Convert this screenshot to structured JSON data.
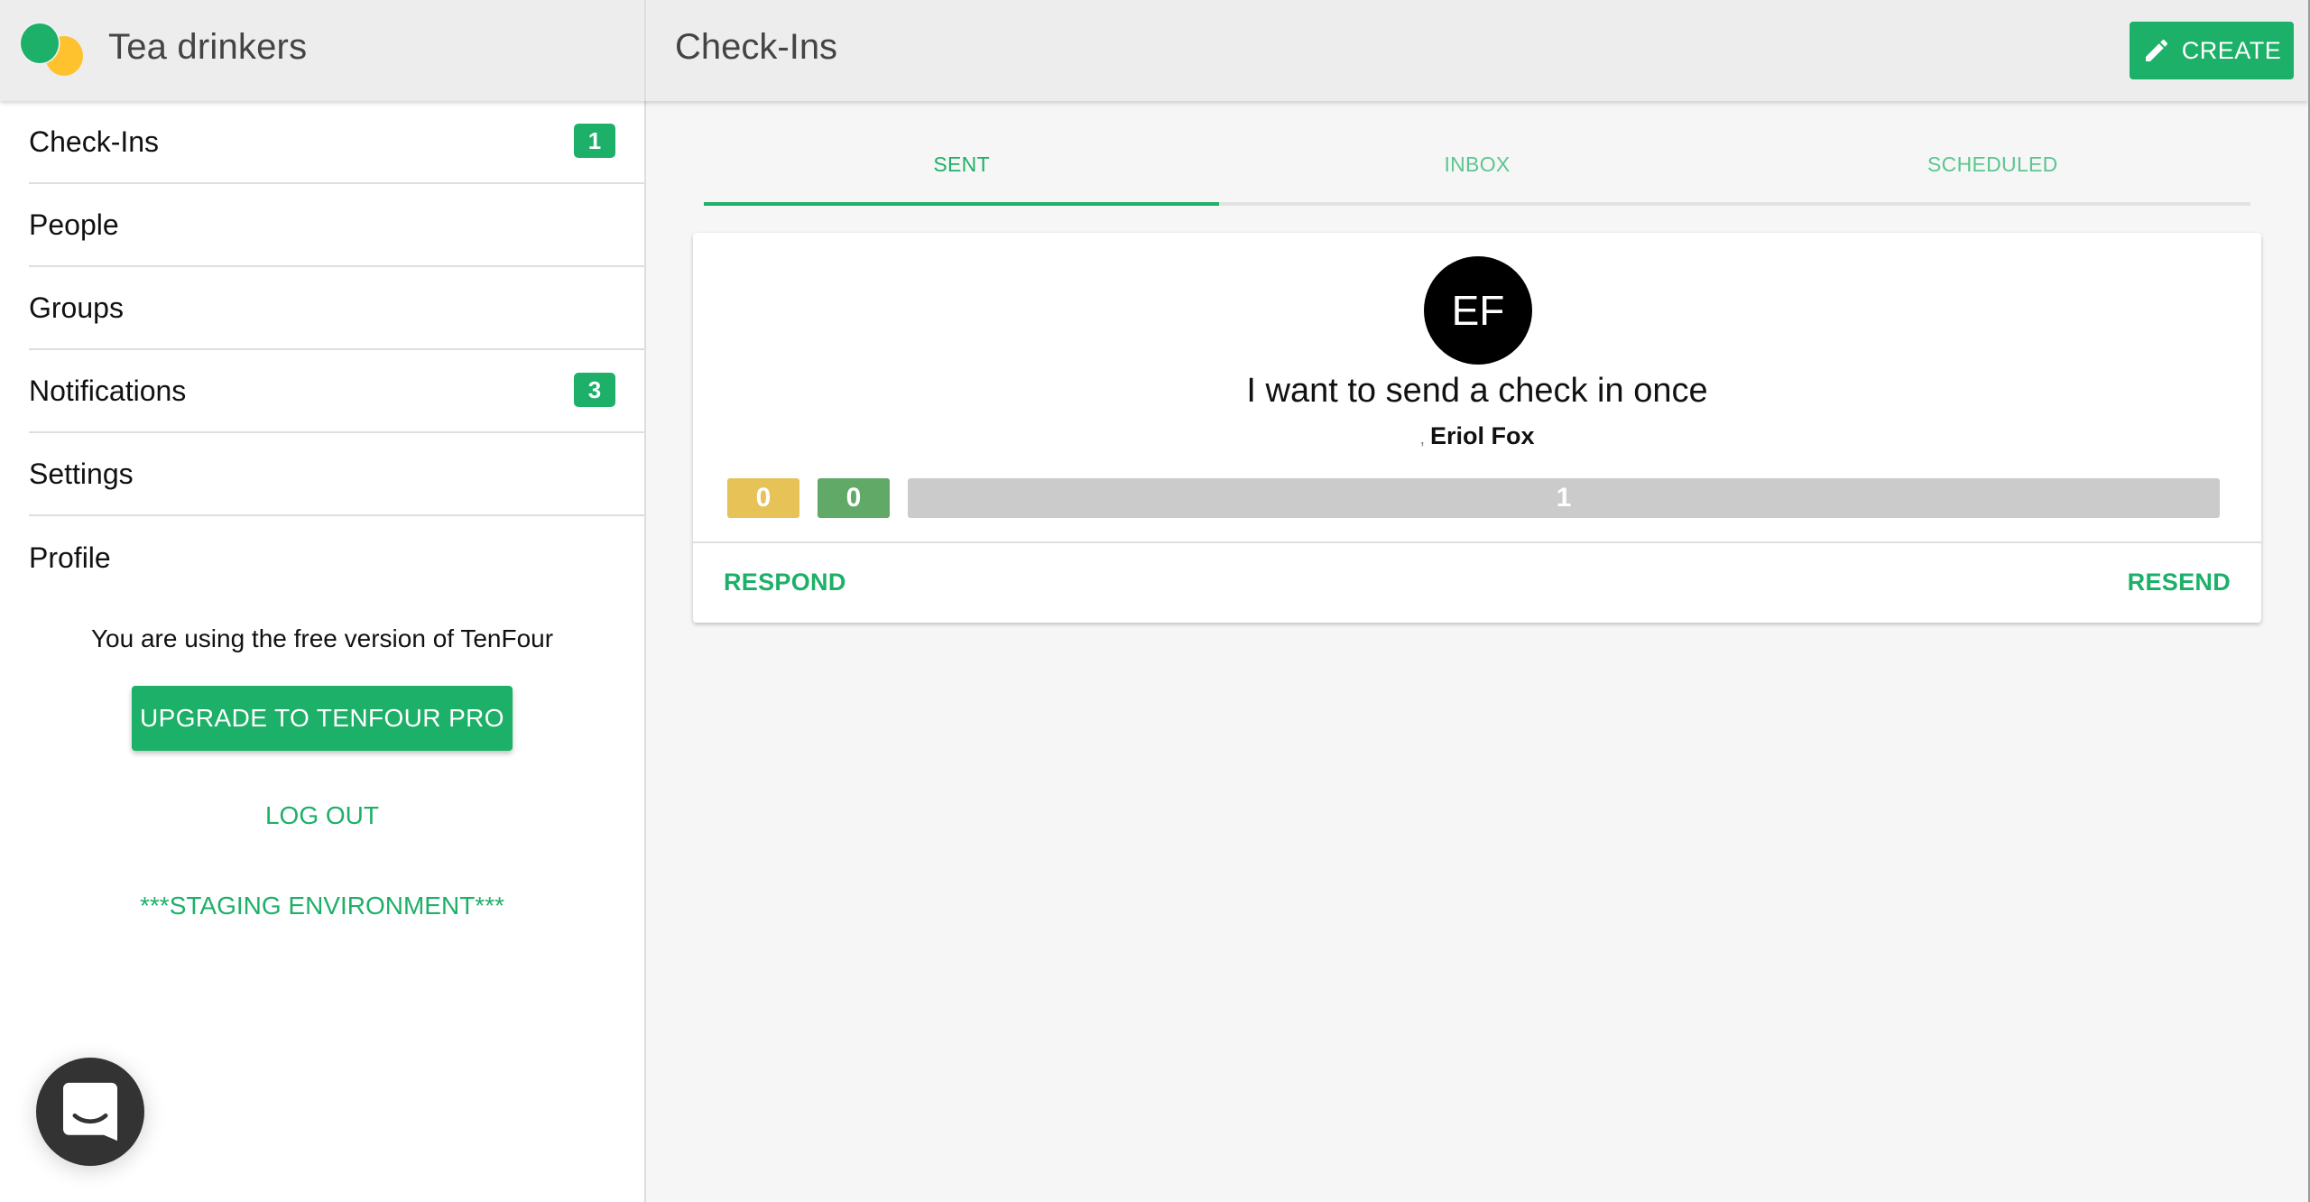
{
  "header": {
    "org_name": "Tea drinkers",
    "page_title": "Check-Ins",
    "create_label": "CREATE",
    "create_icon": "pencil-icon",
    "logo_colors": {
      "primary": "#1db068",
      "secondary": "#fdc22e"
    }
  },
  "sidebar": {
    "items": [
      {
        "label": "Check-Ins",
        "badge": "1"
      },
      {
        "label": "People",
        "badge": null
      },
      {
        "label": "Groups",
        "badge": null
      },
      {
        "label": "Notifications",
        "badge": "3"
      },
      {
        "label": "Settings",
        "badge": null
      },
      {
        "label": "Profile",
        "badge": null
      }
    ],
    "free_version_text": "You are using the free version of TenFour",
    "upgrade_label": "UPGRADE TO TENFOUR PRO",
    "logout_label": "LOG OUT",
    "environment_label": "***STAGING ENVIRONMENT***"
  },
  "tabs": [
    {
      "label": "SENT",
      "active": true
    },
    {
      "label": "INBOX",
      "active": false
    },
    {
      "label": "SCHEDULED",
      "active": false
    }
  ],
  "checkins": [
    {
      "avatar_initials": "EF",
      "message": "I want to send a check in once",
      "sender_prefix": ",",
      "sender_name": "Eriol Fox",
      "stats": {
        "yellow_count": "0",
        "green_count": "0",
        "pending_count": "1"
      },
      "respond_label": "RESPOND",
      "resend_label": "RESEND"
    }
  ],
  "colors": {
    "accent": "#1db068",
    "stat_yellow": "#e6c257",
    "stat_green": "#61a966",
    "stat_gray": "#cbcbcb"
  },
  "chat_launcher": {
    "icon": "chat-bubble-icon"
  }
}
